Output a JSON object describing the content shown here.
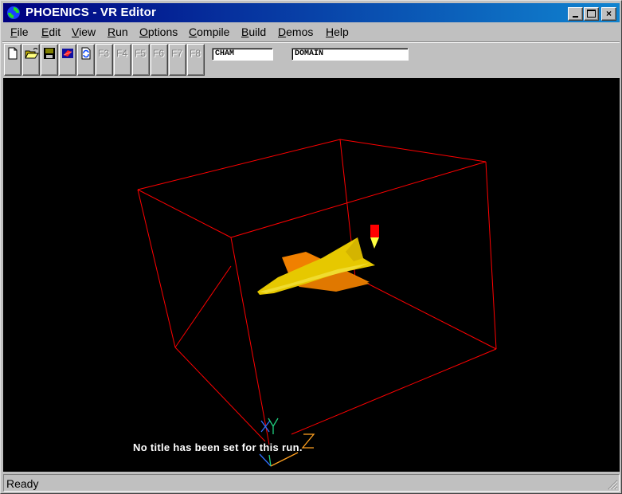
{
  "window": {
    "title": "PHOENICS - VR Editor",
    "controls": {
      "minimize": "_",
      "maximize": "□",
      "close": "×"
    }
  },
  "menu": {
    "items": [
      {
        "label": "File",
        "mnemonic": "F",
        "rest": "ile"
      },
      {
        "label": "Edit",
        "mnemonic": "E",
        "rest": "dit"
      },
      {
        "label": "View",
        "mnemonic": "V",
        "rest": "iew"
      },
      {
        "label": "Run",
        "mnemonic": "R",
        "rest": "un"
      },
      {
        "label": "Options",
        "mnemonic": "O",
        "rest": "ptions"
      },
      {
        "label": "Compile",
        "mnemonic": "C",
        "rest": "ompile"
      },
      {
        "label": "Build",
        "mnemonic": "B",
        "rest": "uild"
      },
      {
        "label": "Demos",
        "mnemonic": "D",
        "rest": "emos"
      },
      {
        "label": "Help",
        "mnemonic": "H",
        "rest": "elp"
      }
    ]
  },
  "toolbar": {
    "icons": [
      "new-file-icon",
      "open-folder-icon",
      "save-disk-icon",
      "view-object-icon",
      "reset-view-icon"
    ],
    "function_keys": [
      "F3",
      "F4",
      "F5",
      "F6",
      "F7",
      "F8"
    ],
    "fields": {
      "left": "CHAM",
      "right": "DOMAIN"
    }
  },
  "viewport": {
    "run_title": "No title has been set for this run.",
    "axes": {
      "x": "X",
      "y": "Y",
      "z": "Z"
    },
    "colors": {
      "domain_box": "#ff0000",
      "object_primary": "#e6c800",
      "object_secondary": "#f08000",
      "probe": "#ff0000",
      "probe_tip": "#ffff40",
      "axis_x": "#3070ff",
      "axis_y": "#20d080",
      "axis_z": "#ffa020"
    }
  },
  "status": {
    "text": "Ready"
  }
}
